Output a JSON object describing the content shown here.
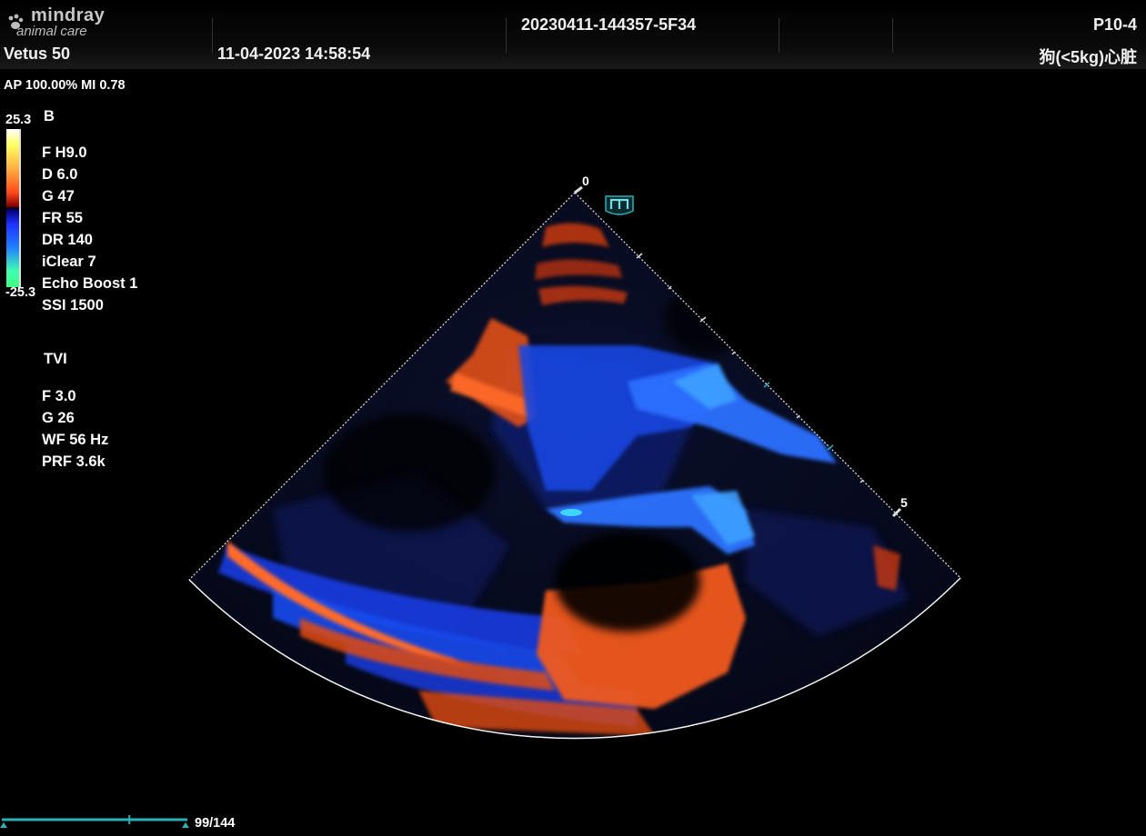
{
  "header": {
    "brand_line1": "mindray",
    "brand_line2": "animal care",
    "device": "Vetus 50",
    "datetime": "11-04-2023  14:58:54",
    "exam_id": "20230411-144357-5F34",
    "probe": "P10-4",
    "preset": "狗(<5kg)心脏"
  },
  "power": "AP 100.00%  MI 0.78",
  "colorbar": {
    "max_label": "25.3",
    "min_label": "-25.3"
  },
  "b_mode": {
    "title": "B",
    "params": [
      "F H9.0",
      "D 6.0",
      "G 47",
      "FR 55",
      "DR 140",
      "iClear 7",
      "Echo Boost 1",
      "SSI 1500"
    ]
  },
  "tvi": {
    "title": "TVI",
    "params": [
      "F 3.0",
      "G 26",
      "WF 56 Hz",
      "PRF 3.6k"
    ]
  },
  "image": {
    "depth_top": "0",
    "depth_mark": "5",
    "orientation_badge": "m-icon"
  },
  "cine": {
    "counter": "99/144",
    "current_frame": 99,
    "total_frames": 144
  },
  "colors": {
    "accent_teal": "#2ab0b8",
    "doppler_red": "#ff5a1a",
    "doppler_blue": "#1a55ff"
  }
}
